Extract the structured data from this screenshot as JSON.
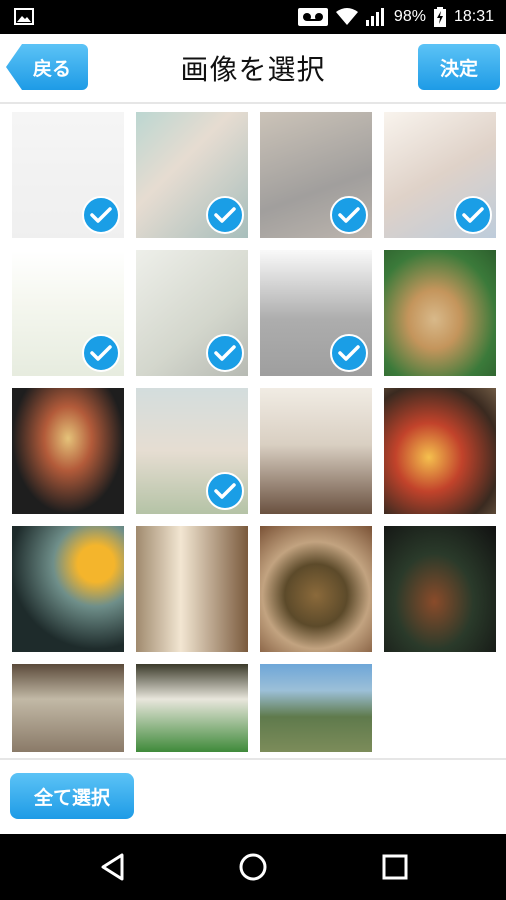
{
  "status_bar": {
    "battery": "98%",
    "time": "18:31",
    "icons": [
      "image-icon",
      "voicemail-icon",
      "wifi-icon",
      "signal-icon",
      "battery-charging-icon"
    ]
  },
  "header": {
    "back_label": "戻る",
    "title": "画像を選択",
    "confirm_label": "決定"
  },
  "photos": [
    {
      "subject": "blank white paper",
      "selected": true
    },
    {
      "subject": "woman at lake",
      "selected": true
    },
    {
      "subject": "person with dog",
      "selected": true
    },
    {
      "subject": "family at table",
      "selected": true
    },
    {
      "subject": "tea cups on table",
      "selected": true
    },
    {
      "subject": "tea set",
      "selected": true
    },
    {
      "subject": "dark teapot",
      "selected": true
    },
    {
      "subject": "white dog",
      "selected": false
    },
    {
      "subject": "sushi box",
      "selected": false
    },
    {
      "subject": "child with soccer ball",
      "selected": true
    },
    {
      "subject": "cafe interior",
      "selected": false
    },
    {
      "subject": "bibimbap bowl",
      "selected": false
    },
    {
      "subject": "lemons and bowls",
      "selected": false
    },
    {
      "subject": "woman at wooden wall",
      "selected": false
    },
    {
      "subject": "noodle bowl",
      "selected": false
    },
    {
      "subject": "skewers on plate",
      "selected": false
    },
    {
      "subject": "grilled fish",
      "selected": false
    },
    {
      "subject": "salad greens",
      "selected": false
    },
    {
      "subject": "aerial landscape",
      "selected": false
    }
  ],
  "footer": {
    "select_all_label": "全て選択"
  },
  "nav_bar": {
    "icons": [
      "back-icon",
      "home-icon",
      "recents-icon"
    ]
  }
}
